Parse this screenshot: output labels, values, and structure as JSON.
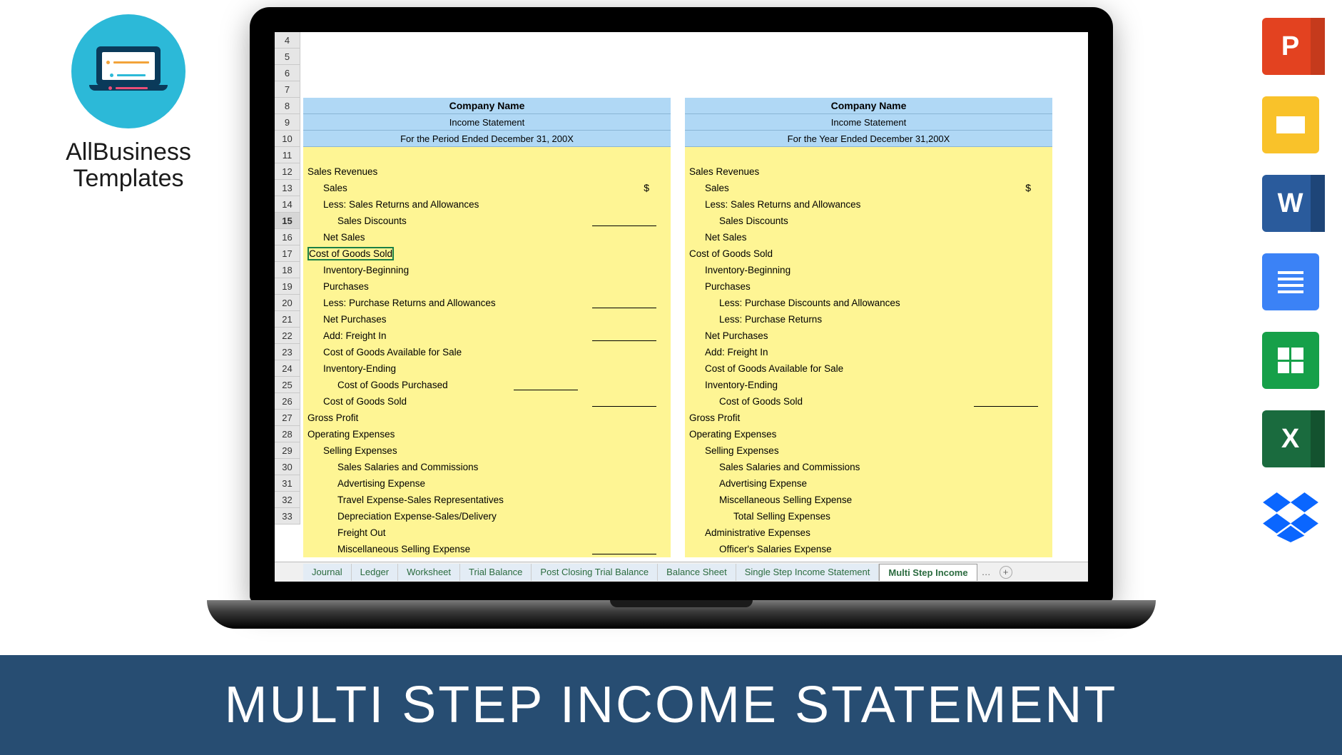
{
  "brand": {
    "line1": "AllBusiness",
    "line2": "Templates"
  },
  "spreadsheet": {
    "row_numbers": [
      "4",
      "5",
      "6",
      "7",
      "8",
      "9",
      "10",
      "11",
      "12",
      "13",
      "14",
      "15",
      "16",
      "17",
      "18",
      "19",
      "20",
      "21",
      "22",
      "23",
      "24",
      "25",
      "26",
      "27",
      "28",
      "29",
      "30",
      "31",
      "32",
      "33"
    ],
    "selected_row": "15",
    "left": {
      "header": {
        "company": "Company Name",
        "title": "Income Statement",
        "period": "For the Period Ended December 31, 200X"
      },
      "lines": [
        {
          "text": "Sales Revenues",
          "indent": 0
        },
        {
          "text": "Sales",
          "indent": 1,
          "dollar": "$"
        },
        {
          "text": "Less:  Sales Returns and Allowances",
          "indent": 1
        },
        {
          "text": "Sales Discounts",
          "indent": 2,
          "ul": true
        },
        {
          "text": "Net Sales",
          "indent": 1
        },
        {
          "text": "Cost of Goods Sold",
          "indent": 0,
          "selected": true
        },
        {
          "text": "Inventory-Beginning",
          "indent": 1
        },
        {
          "text": "Purchases",
          "indent": 1
        },
        {
          "text": "Less:  Purchase Returns and Allowances",
          "indent": 1,
          "ul": true
        },
        {
          "text": "Net Purchases",
          "indent": 1
        },
        {
          "text": "Add:  Freight In",
          "indent": 1,
          "ul": true
        },
        {
          "text": "Cost of Goods Available for Sale",
          "indent": 1
        },
        {
          "text": "Inventory-Ending",
          "indent": 1
        },
        {
          "text": "Cost of Goods Purchased",
          "indent": 2,
          "ul": "far"
        },
        {
          "text": "Cost of Goods Sold",
          "indent": 1,
          "ul": true
        },
        {
          "text": "Gross Profit",
          "indent": 0
        },
        {
          "text": "Operating Expenses",
          "indent": 0
        },
        {
          "text": "Selling Expenses",
          "indent": 1
        },
        {
          "text": "Sales Salaries and Commissions",
          "indent": 2
        },
        {
          "text": "Advertising Expense",
          "indent": 2
        },
        {
          "text": "Travel Expense-Sales Representatives",
          "indent": 2
        },
        {
          "text": "Depreciation Expense-Sales/Delivery",
          "indent": 2
        },
        {
          "text": "Freight Out",
          "indent": 2
        },
        {
          "text": "Miscellaneous Selling Expense",
          "indent": 2,
          "ul": true
        }
      ]
    },
    "right": {
      "header": {
        "company": "Company Name",
        "title": "Income Statement",
        "period": "For the Year Ended December 31,200X"
      },
      "lines": [
        {
          "text": "Sales Revenues",
          "indent": 0
        },
        {
          "text": "Sales",
          "indent": 1,
          "dollar": "$"
        },
        {
          "text": "Less:  Sales Returns and Allowances",
          "indent": 1
        },
        {
          "text": "Sales Discounts",
          "indent": 2
        },
        {
          "text": "Net Sales",
          "indent": 1
        },
        {
          "text": "Cost of Goods Sold",
          "indent": 0
        },
        {
          "text": "Inventory-Beginning",
          "indent": 1
        },
        {
          "text": "Purchases",
          "indent": 1
        },
        {
          "text": "Less:  Purchase Discounts and Allowances",
          "indent": 2
        },
        {
          "text": "Less:  Purchase Returns",
          "indent": 2
        },
        {
          "text": "Net Purchases",
          "indent": 1
        },
        {
          "text": "Add:  Freight In",
          "indent": 1
        },
        {
          "text": "Cost of Goods Available for Sale",
          "indent": 1
        },
        {
          "text": "Inventory-Ending",
          "indent": 1
        },
        {
          "text": "Cost of Goods Sold",
          "indent": 2,
          "ul": true
        },
        {
          "text": "Gross Profit",
          "indent": 0
        },
        {
          "text": "Operating Expenses",
          "indent": 0
        },
        {
          "text": "Selling Expenses",
          "indent": 1
        },
        {
          "text": "Sales Salaries and Commissions",
          "indent": 2
        },
        {
          "text": "Advertising Expense",
          "indent": 2
        },
        {
          "text": "Miscellaneous Selling Expense",
          "indent": 2
        },
        {
          "text": "Total Selling Expenses",
          "indent": 3
        },
        {
          "text": "Administrative Expenses",
          "indent": 1
        },
        {
          "text": "Officer's Salaries Expense",
          "indent": 2
        }
      ]
    },
    "tabs": [
      {
        "label": "Journal",
        "active": false
      },
      {
        "label": "Ledger",
        "active": false
      },
      {
        "label": "Worksheet",
        "active": false
      },
      {
        "label": "Trial Balance",
        "active": false
      },
      {
        "label": "Post Closing Trial Balance",
        "active": false
      },
      {
        "label": "Balance Sheet",
        "active": false
      },
      {
        "label": "Single Step Income Statement",
        "active": false
      },
      {
        "label": "Multi Step Income",
        "active": true
      }
    ],
    "tabs_more": "…"
  },
  "icons": [
    {
      "name": "powerpoint-icon"
    },
    {
      "name": "google-slides-icon"
    },
    {
      "name": "word-icon"
    },
    {
      "name": "google-docs-icon"
    },
    {
      "name": "google-sheets-icon"
    },
    {
      "name": "excel-icon"
    },
    {
      "name": "dropbox-icon"
    }
  ],
  "banner": "MULTI STEP INCOME STATEMENT"
}
